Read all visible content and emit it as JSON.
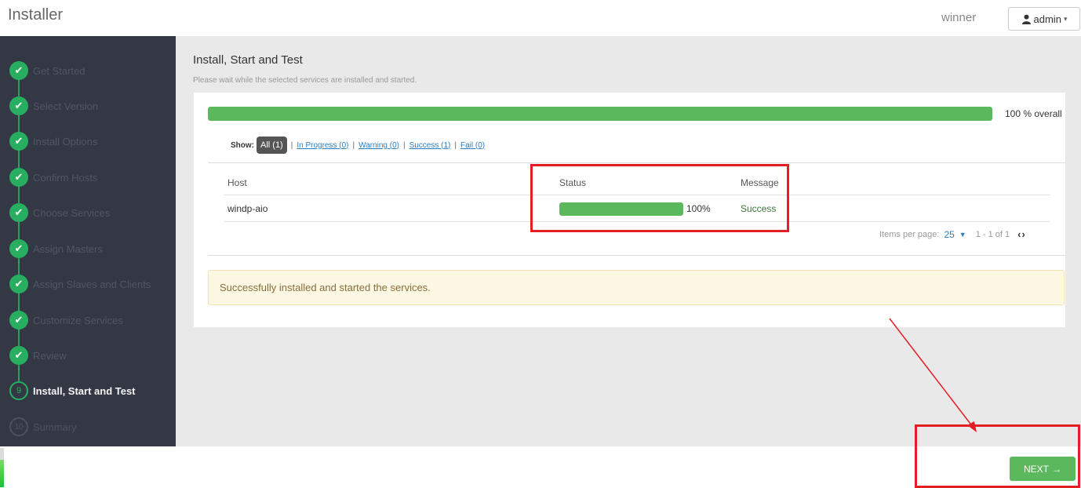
{
  "header": {
    "app_title": "Installer",
    "cluster_name": "winner",
    "user_label": "admin"
  },
  "sidebar": {
    "steps": [
      {
        "label": "Get Started",
        "state": "done"
      },
      {
        "label": "Select Version",
        "state": "done"
      },
      {
        "label": "Install Options",
        "state": "done"
      },
      {
        "label": "Confirm Hosts",
        "state": "done"
      },
      {
        "label": "Choose Services",
        "state": "done"
      },
      {
        "label": "Assign Masters",
        "state": "done"
      },
      {
        "label": "Assign Slaves and Clients",
        "state": "done"
      },
      {
        "label": "Customize Services",
        "state": "done"
      },
      {
        "label": "Review",
        "state": "done"
      },
      {
        "label": "Install, Start and Test",
        "state": "current",
        "number": "9"
      },
      {
        "label": "Summary",
        "state": "pending",
        "number": "10"
      }
    ]
  },
  "main": {
    "title": "Install, Start and Test",
    "subtitle": "Please wait while the selected services are installed and started.",
    "overall_progress": 1.0,
    "overall_text": "100 % overall",
    "filters": {
      "show_label": "Show:",
      "all": "All (1)",
      "in_progress": "In Progress (0)",
      "warning": "Warning (0)",
      "success": "Success (1)",
      "fail": "Fail (0)",
      "separator": "|"
    },
    "table": {
      "headers": {
        "host": "Host",
        "status": "Status",
        "message": "Message"
      },
      "rows": [
        {
          "host": "windp-aio",
          "progress": 1.0,
          "percent": "100%",
          "message": "Success"
        }
      ]
    },
    "pagination": {
      "label": "Items per page:",
      "per_page": "25",
      "range": "1 - 1 of 1"
    },
    "alert": "Successfully installed and started the services."
  },
  "footer": {
    "next_label": "NEXT",
    "next_arrow": "→",
    "page_progress": 0.7
  },
  "colors": {
    "sidebar_bg": "#333844",
    "step_done": "#27ae60",
    "progress_green": "#5cb85c",
    "annotation_red": "#e41e25"
  }
}
